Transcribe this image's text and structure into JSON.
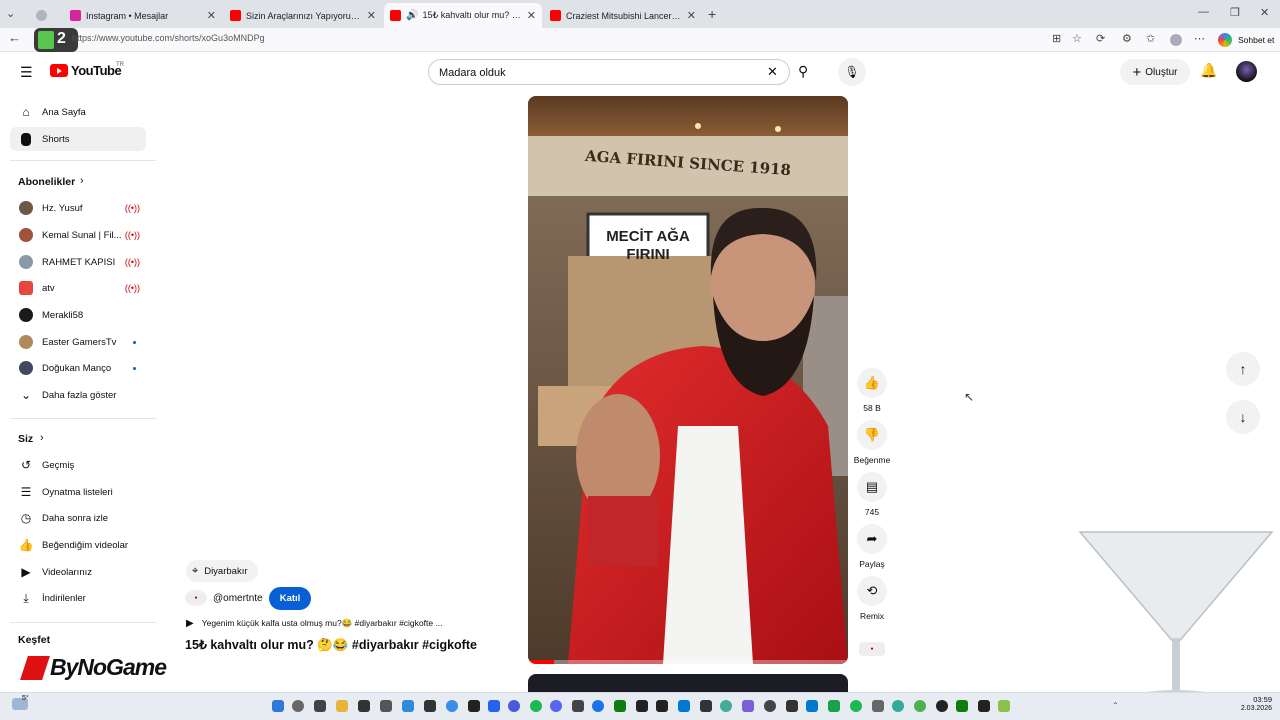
{
  "browser": {
    "tabs": [
      {
        "title": "",
        "fav_color": "#9aa0a6"
      },
      {
        "title": "Instagram • Mesajlar",
        "fav_color": "#d6249f"
      },
      {
        "title": "Sizin Araçlarınızı Yapıyoruz 1. Bölüm",
        "fav_color": "#ff0000"
      },
      {
        "title": "15₺ kahvaltı olur mu? 🤔😂 #",
        "fav_color": "#ff0000"
      },
      {
        "title": "Craziest Mitsubishi Lancer Evolution",
        "fav_color": "#ff0000"
      }
    ],
    "url": "https://www.youtube.com/shorts/xoGu3oMNDPg",
    "copilot_label": "Sohbet et"
  },
  "youtube": {
    "logo_text": "YouTube",
    "logo_region": "TR",
    "search_value": "Madara olduk",
    "create_label": "Oluştur"
  },
  "sidebar": {
    "main": [
      {
        "label": "Ana Sayfa",
        "icon": "home-icon"
      },
      {
        "label": "Shorts",
        "icon": "shorts-icon"
      }
    ],
    "subs_title": "Abonelikler",
    "subs": [
      {
        "label": "Hz. Yusuf",
        "color": "#6b5a4a",
        "status": "live"
      },
      {
        "label": "Kemal Sunal | Fil...",
        "color": "#a0523c",
        "status": "live"
      },
      {
        "label": "RAHMET KAPISI",
        "color": "#8c9aa8",
        "status": "live"
      },
      {
        "label": "atv",
        "color": "#e8463c",
        "status": "live"
      },
      {
        "label": "Merakli58",
        "color": "#1a1a1a",
        "status": ""
      },
      {
        "label": "Easter GamersTv",
        "color": "#b08a5a",
        "status": "dot"
      },
      {
        "label": "Doğukan Manço",
        "color": "#3d4b5c",
        "status": "dot"
      }
    ],
    "show_more": "Daha fazla göster",
    "you_title": "Siz",
    "you": [
      {
        "label": "Geçmiş",
        "icon": "history-icon"
      },
      {
        "label": "Oynatma listeleri",
        "icon": "playlists-icon"
      },
      {
        "label": "Daha sonra izle",
        "icon": "watch-later-icon"
      },
      {
        "label": "Beğendiğim videolar",
        "icon": "liked-icon"
      },
      {
        "label": "Videolarınız",
        "icon": "your-videos-icon"
      },
      {
        "label": "İndirilenler",
        "icon": "downloads-icon"
      }
    ],
    "explore_title": "Keşfet"
  },
  "short": {
    "location": "Diyarbakır",
    "channel": "@omertnte",
    "join_label": "Katıl",
    "desc": "Yegenim küçük kalfa usta olmuş mu?😂 #diyarbakır #cigkofte ...",
    "title": "15₺ kahvaltı olur mu? 🤔😂 #diyarbakır #cigkofte",
    "sign_top": "AGA FIRINI SINCE 1918",
    "sign_main_1": "MECİT AĞA",
    "sign_main_2": "FIRINI",
    "progress": 0.08
  },
  "actions": {
    "likes": "58 B",
    "dislike": "Beğenme",
    "comments": "745",
    "share": "Paylaş",
    "remix": "Remix"
  },
  "overlay": {
    "watermark": "ByNoGame",
    "corner_badge": "2"
  },
  "taskbar": {
    "temp": "5°",
    "time": "03:59",
    "date": "2.03.2026"
  }
}
